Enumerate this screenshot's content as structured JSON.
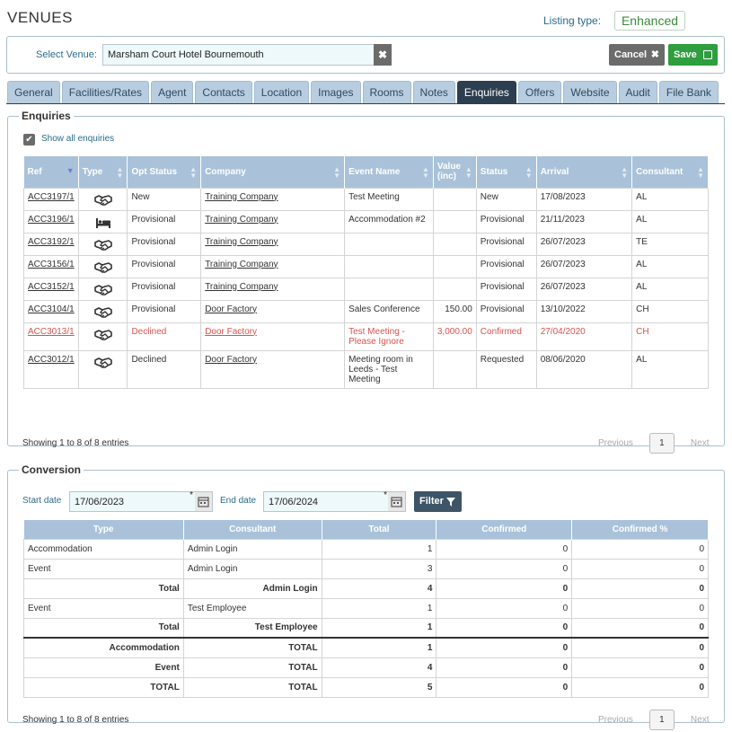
{
  "page": {
    "title": "VENUES",
    "listing_type_label": "Listing type:",
    "listing_type_value": "Enhanced"
  },
  "venue": {
    "label": "Select Venue:",
    "value": "Marsham Court Hotel Bournemouth",
    "cancel_label": "Cancel",
    "save_label": "Save"
  },
  "tabs": [
    "General",
    "Facilities/Rates",
    "Agent",
    "Contacts",
    "Location",
    "Images",
    "Rooms",
    "Notes",
    "Enquiries",
    "Offers",
    "Website",
    "Audit",
    "File Bank"
  ],
  "active_tab": "Enquiries",
  "enquiries": {
    "legend": "Enquiries",
    "show_all_label": "Show all enquiries",
    "show_all_checked": true,
    "columns": [
      "Ref",
      "Type",
      "Opt Status",
      "Company",
      "Event Name",
      "Value (inc)",
      "Status",
      "Arrival",
      "Consultant"
    ],
    "rows": [
      {
        "ref": "ACC3197/1",
        "type": "event",
        "opt": "New",
        "company": "Training Company",
        "event": "Test Meeting",
        "value": "",
        "status": "New",
        "arrival": "17/08/2023",
        "consultant": "AL",
        "declined": false
      },
      {
        "ref": "ACC3196/1",
        "type": "accommodation",
        "opt": "Provisional",
        "company": "Training Company",
        "event": "Accommodation #2",
        "value": "",
        "status": "Provisional",
        "arrival": "21/11/2023",
        "consultant": "AL",
        "declined": false
      },
      {
        "ref": "ACC3192/1",
        "type": "event",
        "opt": "Provisional",
        "company": "Training Company",
        "event": "",
        "value": "",
        "status": "Provisional",
        "arrival": "26/07/2023",
        "consultant": "TE",
        "declined": false
      },
      {
        "ref": "ACC3156/1",
        "type": "event",
        "opt": "Provisional",
        "company": "Training Company",
        "event": "",
        "value": "",
        "status": "Provisional",
        "arrival": "26/07/2023",
        "consultant": "AL",
        "declined": false
      },
      {
        "ref": "ACC3152/1",
        "type": "event",
        "opt": "Provisional",
        "company": "Training Company",
        "event": "",
        "value": "",
        "status": "Provisional",
        "arrival": "26/07/2023",
        "consultant": "AL",
        "declined": false
      },
      {
        "ref": "ACC3104/1",
        "type": "event",
        "opt": "Provisional",
        "company": "Door Factory",
        "event": "Sales Conference",
        "value": "150.00",
        "status": "Provisional",
        "arrival": "13/10/2022",
        "consultant": "CH",
        "declined": false
      },
      {
        "ref": "ACC3013/1",
        "type": "event",
        "opt": "Declined",
        "company": "Door Factory",
        "event": "Test Meeting - Please Ignore",
        "value": "3,000.00",
        "status": "Confirmed",
        "arrival": "27/04/2020",
        "consultant": "CH",
        "declined": true
      },
      {
        "ref": "ACC3012/1",
        "type": "event",
        "opt": "Declined",
        "company": "Door Factory",
        "event": "Meeting room in Leeds - Test Meeting",
        "value": "",
        "status": "Requested",
        "arrival": "08/06/2020",
        "consultant": "AL",
        "declined": false
      }
    ],
    "showing": "Showing 1 to 8 of 8 entries",
    "pager": {
      "previous": "Previous",
      "page": "1",
      "next": "Next"
    }
  },
  "conversion": {
    "legend": "Conversion",
    "start_label": "Start date",
    "start_value": "17/06/2023",
    "end_label": "End date",
    "end_value": "17/06/2024",
    "filter_label": "Filter",
    "columns": [
      "Type",
      "Consultant",
      "Total",
      "Confirmed",
      "Confirmed %"
    ],
    "rows": [
      {
        "type": "Accommodation",
        "consultant": "Admin Login",
        "total": "1",
        "confirmed": "0",
        "pct": "0",
        "bold": false,
        "sep": false
      },
      {
        "type": "Event",
        "consultant": "Admin Login",
        "total": "3",
        "confirmed": "0",
        "pct": "0",
        "bold": false,
        "sep": false
      },
      {
        "type": "Total",
        "consultant": "Admin Login",
        "total": "4",
        "confirmed": "0",
        "pct": "0",
        "bold": true,
        "sep": false
      },
      {
        "type": "Event",
        "consultant": "Test Employee",
        "total": "1",
        "confirmed": "0",
        "pct": "0",
        "bold": false,
        "sep": false
      },
      {
        "type": "Total",
        "consultant": "Test Employee",
        "total": "1",
        "confirmed": "0",
        "pct": "0",
        "bold": true,
        "sep": false
      },
      {
        "type": "Accommodation",
        "consultant": "TOTAL",
        "total": "1",
        "confirmed": "0",
        "pct": "0",
        "bold": true,
        "sep": true
      },
      {
        "type": "Event",
        "consultant": "TOTAL",
        "total": "4",
        "confirmed": "0",
        "pct": "0",
        "bold": true,
        "sep": false
      },
      {
        "type": "TOTAL",
        "consultant": "TOTAL",
        "total": "5",
        "confirmed": "0",
        "pct": "0",
        "bold": true,
        "sep": false
      }
    ],
    "showing": "Showing 1 to 8 of 8 entries",
    "pager": {
      "previous": "Previous",
      "page": "1",
      "next": "Next"
    }
  },
  "icons": {
    "event": "handshake-icon",
    "accommodation": "bed-icon",
    "calendar": "calendar-icon",
    "filter": "filter-icon",
    "save": "floppy-disk-icon",
    "clear": "times-icon"
  }
}
